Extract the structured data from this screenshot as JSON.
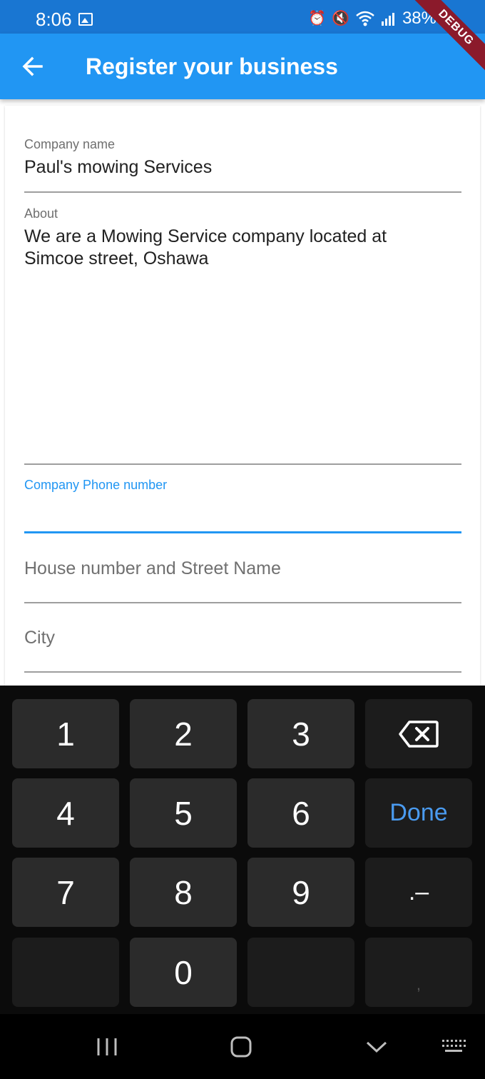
{
  "status": {
    "time": "8:06",
    "battery": "38%"
  },
  "debug_banner": "DEBUG",
  "app_bar": {
    "title": "Register your business"
  },
  "form": {
    "company_name": {
      "label": "Company name",
      "value": "Paul's mowing Services"
    },
    "about": {
      "label": "About",
      "value": "We are a Mowing Service company located at Simcoe street, Oshawa"
    },
    "phone": {
      "label": "Company Phone number",
      "value": ""
    },
    "street": {
      "placeholder": "House number and Street Name"
    },
    "city": {
      "placeholder": "City"
    }
  },
  "keyboard": {
    "keys": [
      "1",
      "2",
      "3",
      "4",
      "5",
      "6",
      "Done",
      "7",
      "8",
      "9",
      ".–",
      "0"
    ],
    "comma": ","
  },
  "colors": {
    "status_bar": "#1976d2",
    "app_bar": "#2196f3",
    "accent": "#2196f3",
    "keyboard_bg": "#0b0b0b",
    "done_key": "#4a9bf0"
  }
}
